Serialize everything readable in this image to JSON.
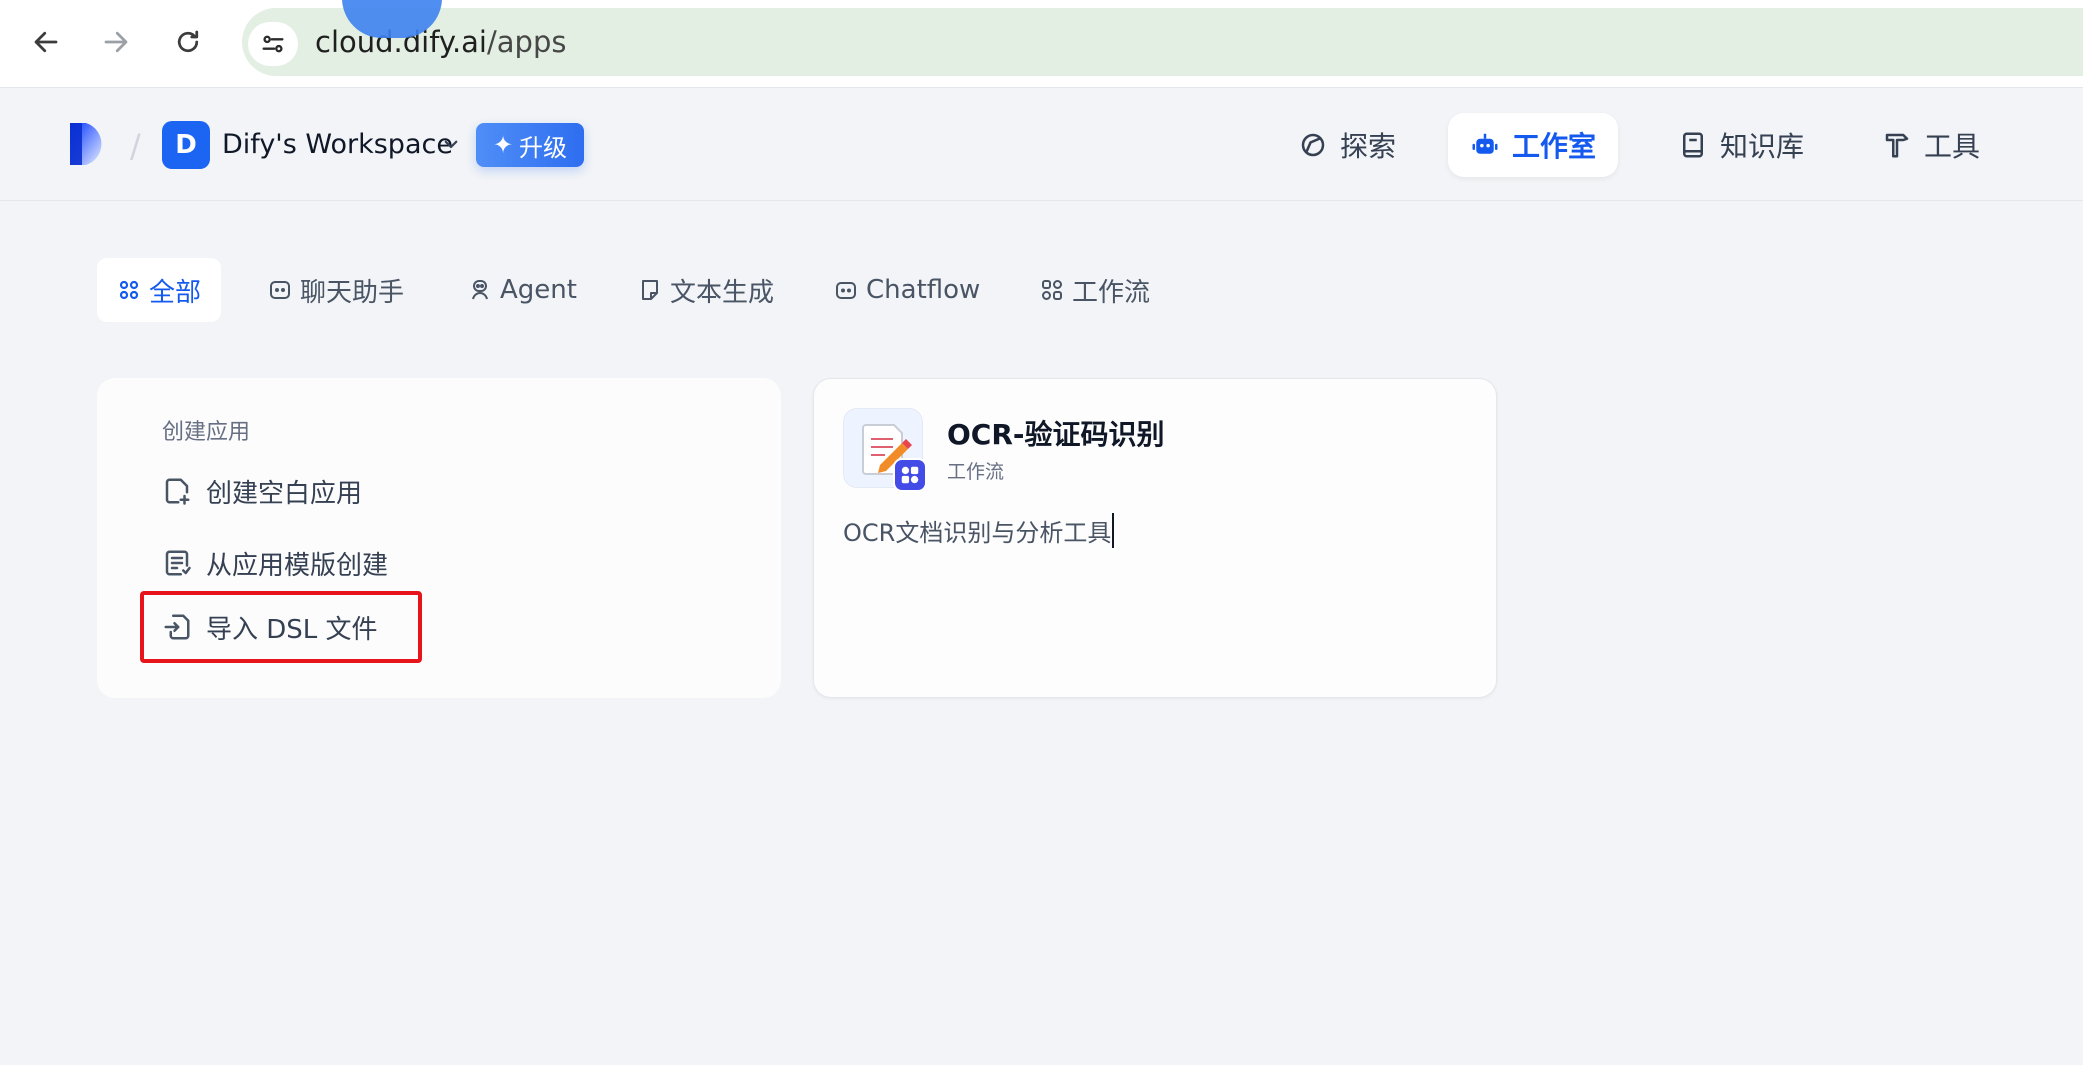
{
  "browser": {
    "url_host": "cloud.dify.ai",
    "url_path": "/apps",
    "accent_color": "#e3efe2"
  },
  "header": {
    "workspace_initial": "D",
    "workspace_name": "Dify's Workspace",
    "upgrade_label": "升级",
    "nav": [
      {
        "label": "探索",
        "icon": "compass-icon",
        "active": false
      },
      {
        "label": "工作室",
        "icon": "robot-icon",
        "active": true
      },
      {
        "label": "知识库",
        "icon": "book-icon",
        "active": false
      },
      {
        "label": "工具",
        "icon": "hammer-icon",
        "active": false
      }
    ]
  },
  "tabs": [
    {
      "label": "全部",
      "icon": "grid-icon",
      "active": true
    },
    {
      "label": "聊天助手",
      "icon": "chat-icon",
      "active": false
    },
    {
      "label": "Agent",
      "icon": "agent-icon",
      "active": false
    },
    {
      "label": "文本生成",
      "icon": "file-icon",
      "active": false
    },
    {
      "label": "Chatflow",
      "icon": "chatflow-icon",
      "active": false
    },
    {
      "label": "工作流",
      "icon": "workflow-icon",
      "active": false
    }
  ],
  "create_card": {
    "title": "创建应用",
    "items": [
      {
        "label": "创建空白应用",
        "icon": "file-plus-icon"
      },
      {
        "label": "从应用模版创建",
        "icon": "template-icon"
      },
      {
        "label": "导入 DSL 文件",
        "icon": "import-icon"
      }
    ]
  },
  "app_card": {
    "name": "OCR-验证码识别",
    "type": "工作流",
    "description": "OCR文档识别与分析工具",
    "icon": "memo-pencil-icon",
    "badge_icon": "workflow-badge-icon"
  },
  "colors": {
    "primary": "#155aef",
    "highlight": "#e8141b",
    "background": "#f2f4f7"
  }
}
